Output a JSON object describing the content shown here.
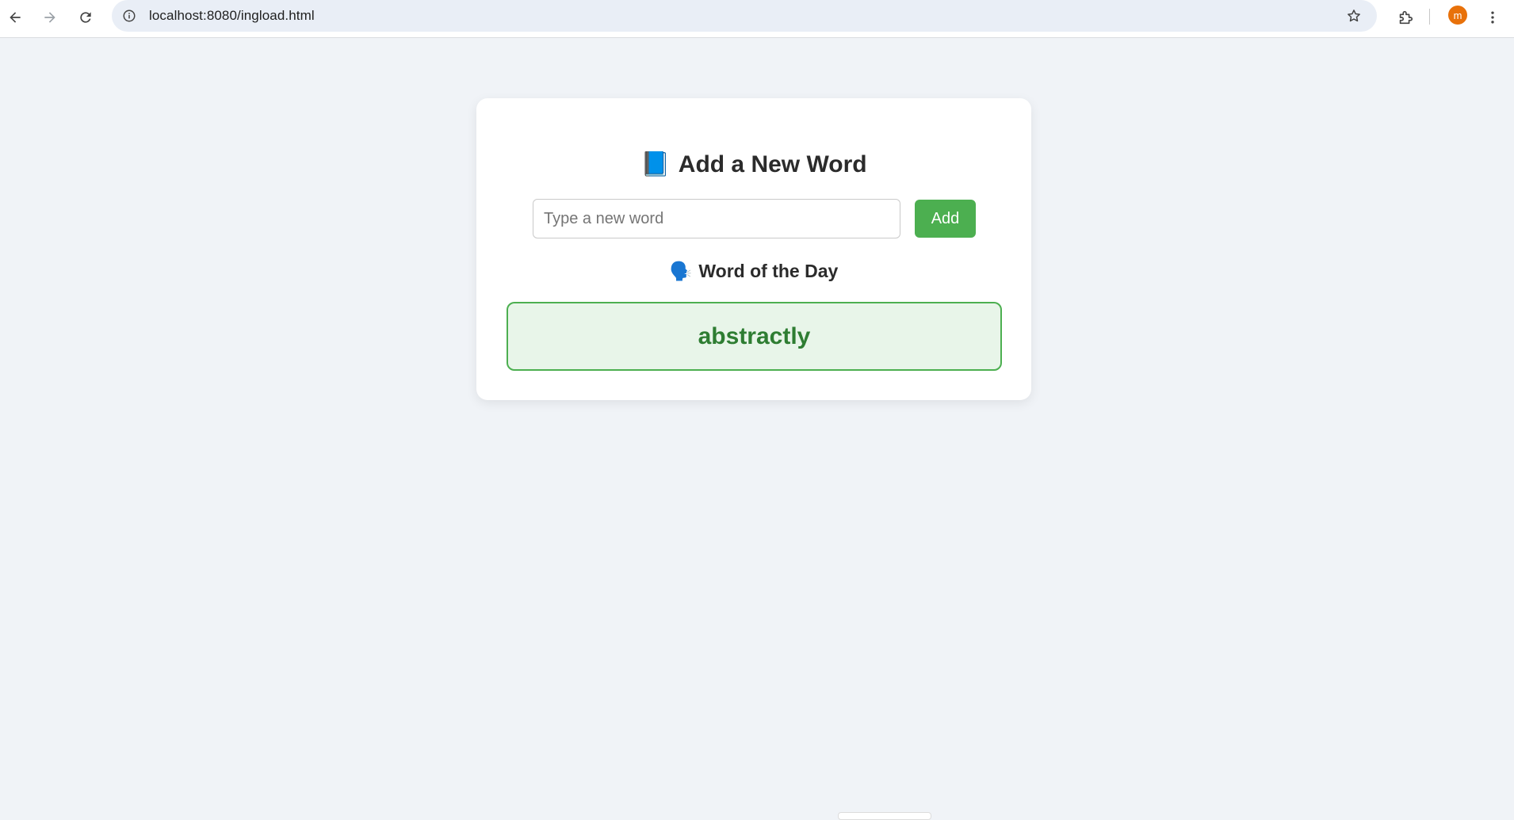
{
  "browser": {
    "url": "localhost:8080/ingload.html",
    "profile_initial": "m",
    "profile_color": "#e8710a"
  },
  "card": {
    "title_emoji": "📘",
    "title": "Add a New Word",
    "input_placeholder": "Type a new word",
    "input_value": "",
    "add_label": "Add",
    "wotd_emoji": "🗣️",
    "wotd_title": "Word of the Day",
    "word": "abstractly"
  },
  "colors": {
    "accent": "#4caf50",
    "word_text": "#2e7d32",
    "word_bg": "#e8f5e9",
    "page_bg": "#f0f3f7"
  }
}
